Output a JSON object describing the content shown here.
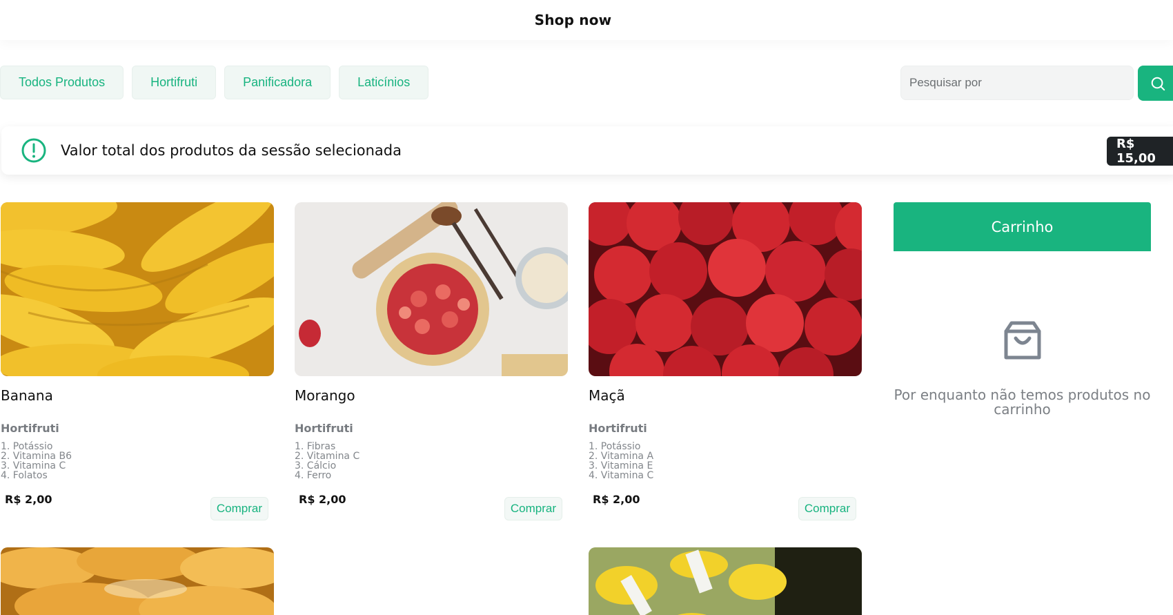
{
  "header": {
    "title": "Shop now"
  },
  "filters": [
    "Todos Produtos",
    "Hortifruti",
    "Panificadora",
    "Laticínios"
  ],
  "search": {
    "placeholder": "Pesquisar por",
    "button_icon": "search-icon"
  },
  "summary": {
    "icon": "alert-circle-icon",
    "text": "Valor total dos produtos da sessão selecionada",
    "total": "R$ 15,00"
  },
  "products": [
    {
      "name": "Banana",
      "category": "Hortifruti",
      "benefits": [
        "1. Potássio",
        "2. Vitamina B6",
        "3. Vitamina C",
        "4. Folatos"
      ],
      "price": "R$ 2,00",
      "buy_label": "Comprar",
      "image": "bananas-photo"
    },
    {
      "name": "Morango",
      "category": "Hortifruti",
      "benefits": [
        "1. Fibras",
        "2. Vitamina C",
        "3. Cálcio",
        "4. Ferro"
      ],
      "price": "R$ 2,00",
      "buy_label": "Comprar",
      "image": "strawberry-tart-photo"
    },
    {
      "name": "Maçã",
      "category": "Hortifruti",
      "benefits": [
        "1. Potássio",
        "2. Vitamina A",
        "3. Vitamina E",
        "4. Vitamina C"
      ],
      "price": "R$ 2,00",
      "buy_label": "Comprar",
      "image": "apples-photo"
    }
  ],
  "more_products": [
    {
      "image": "bread-photo"
    },
    {
      "image": "milk-bottles-photo"
    }
  ],
  "cart": {
    "title": "Carrinho",
    "empty_icon": "shopping-bag-icon",
    "empty_text": "Por enquanto não temos produtos no carrinho"
  },
  "colors": {
    "accent": "#19b47f",
    "chip_bg": "#f0f7f4",
    "badge_bg": "#1f2326"
  }
}
